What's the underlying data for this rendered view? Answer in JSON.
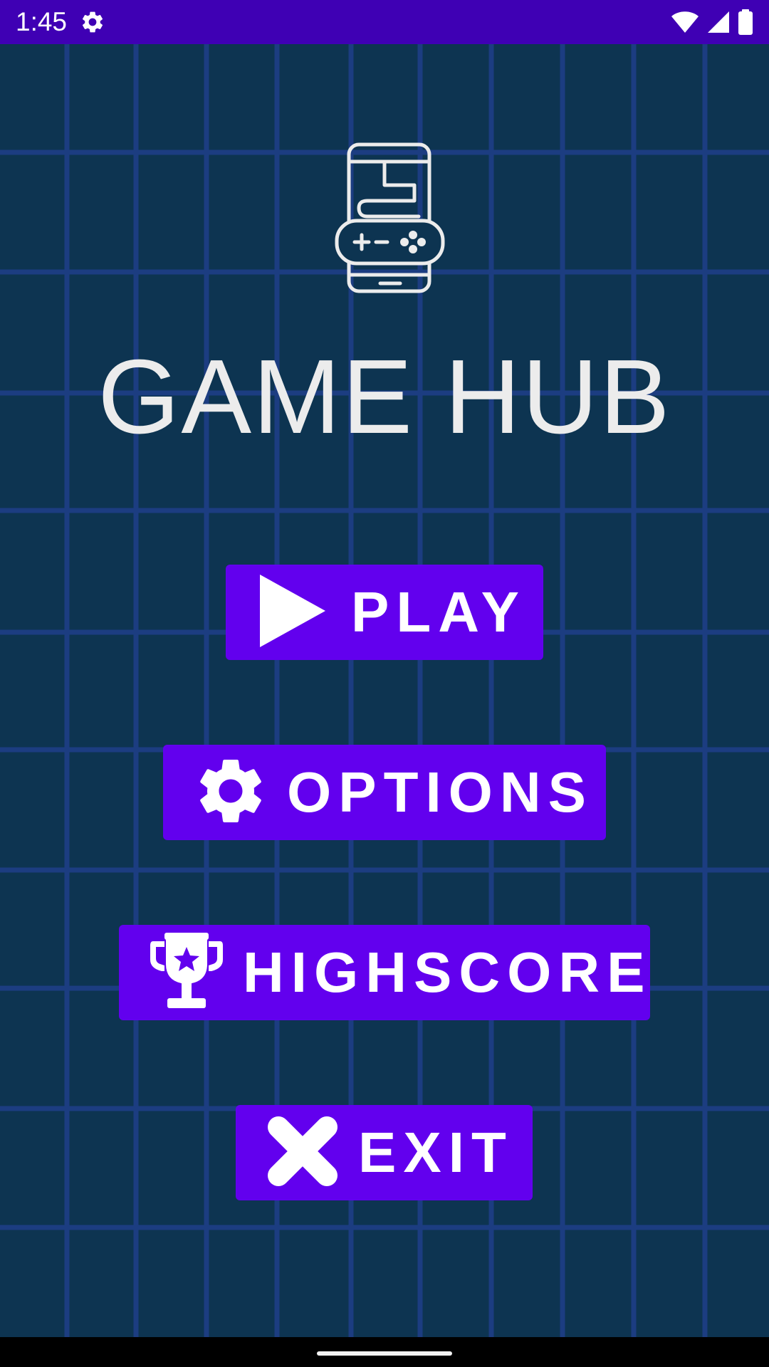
{
  "status_bar": {
    "time": "1:45",
    "icons": [
      "settings-gear-icon",
      "wifi-icon",
      "cellular-signal-icon",
      "battery-icon"
    ]
  },
  "app": {
    "title": "GAME HUB",
    "logo_icon": "handheld-game-console-icon"
  },
  "menu": {
    "items": [
      {
        "label": "PLAY",
        "icon": "play-icon"
      },
      {
        "label": "OPTIONS",
        "icon": "gear-icon"
      },
      {
        "label": "HIGHSCORE",
        "icon": "trophy-icon"
      },
      {
        "label": "EXIT",
        "icon": "close-icon"
      }
    ]
  },
  "colors": {
    "status_bar": "#3f00b4",
    "background": "#0d3451",
    "grid_line": "#1f3f8a",
    "button": "#6200ee",
    "title_text": "#ececec",
    "button_text": "#ffffff"
  }
}
